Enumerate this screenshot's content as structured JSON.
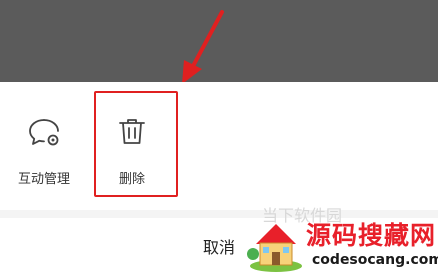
{
  "actions": [
    {
      "id": "interact-manage",
      "label": "互动管理",
      "icon": "chat-settings-icon"
    },
    {
      "id": "delete",
      "label": "删除",
      "icon": "trash-icon"
    }
  ],
  "cancel_label": "取消",
  "watermark": {
    "faint_text": "当下软件园",
    "title": "源码搜藏网",
    "url": "codesocang.com"
  },
  "colors": {
    "overlay": "#5b5b5b",
    "highlight": "#e02020",
    "watermark_red": "#e8202a"
  },
  "icons": [
    "chat-settings-icon",
    "trash-icon",
    "arrow-annotation-icon",
    "house-logo-icon"
  ]
}
